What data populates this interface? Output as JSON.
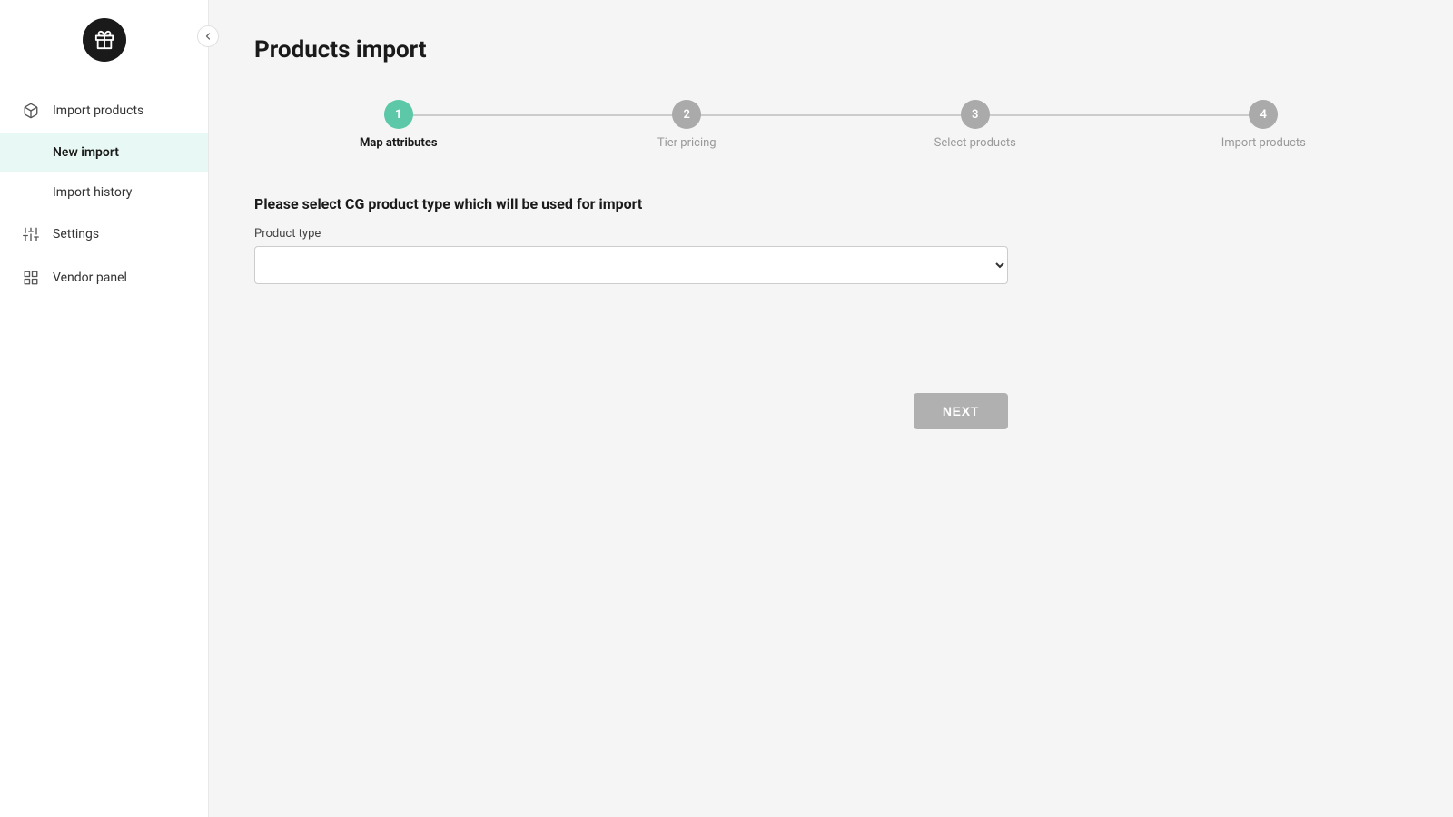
{
  "sidebar": {
    "logo_icon": "gift-icon",
    "collapse_icon": "chevron-left-icon",
    "items": [
      {
        "id": "import-products",
        "label": "Import products",
        "icon": "package-icon",
        "active": false
      },
      {
        "id": "new-import",
        "label": "New import",
        "icon": null,
        "active": true
      },
      {
        "id": "import-history",
        "label": "Import history",
        "icon": null,
        "active": false
      },
      {
        "id": "settings",
        "label": "Settings",
        "icon": "sliders-icon",
        "active": false
      },
      {
        "id": "vendor-panel",
        "label": "Vendor panel",
        "icon": "grid-icon",
        "active": false
      }
    ]
  },
  "main": {
    "page_title": "Products import",
    "stepper": {
      "steps": [
        {
          "number": "1",
          "label": "Map attributes",
          "state": "active"
        },
        {
          "number": "2",
          "label": "Tier pricing",
          "state": "inactive"
        },
        {
          "number": "3",
          "label": "Select products",
          "state": "inactive"
        },
        {
          "number": "4",
          "label": "Import products",
          "state": "inactive"
        }
      ]
    },
    "form": {
      "heading": "Please select CG product type which will be used for import",
      "product_type_label": "Product type",
      "product_type_placeholder": "",
      "product_type_options": []
    },
    "next_button_label": "NEXT"
  },
  "colors": {
    "active_step": "#5dc8a8",
    "inactive_step": "#aaaaaa",
    "next_button": "#b0b0b0",
    "active_nav_bg": "#e8f8f4"
  }
}
